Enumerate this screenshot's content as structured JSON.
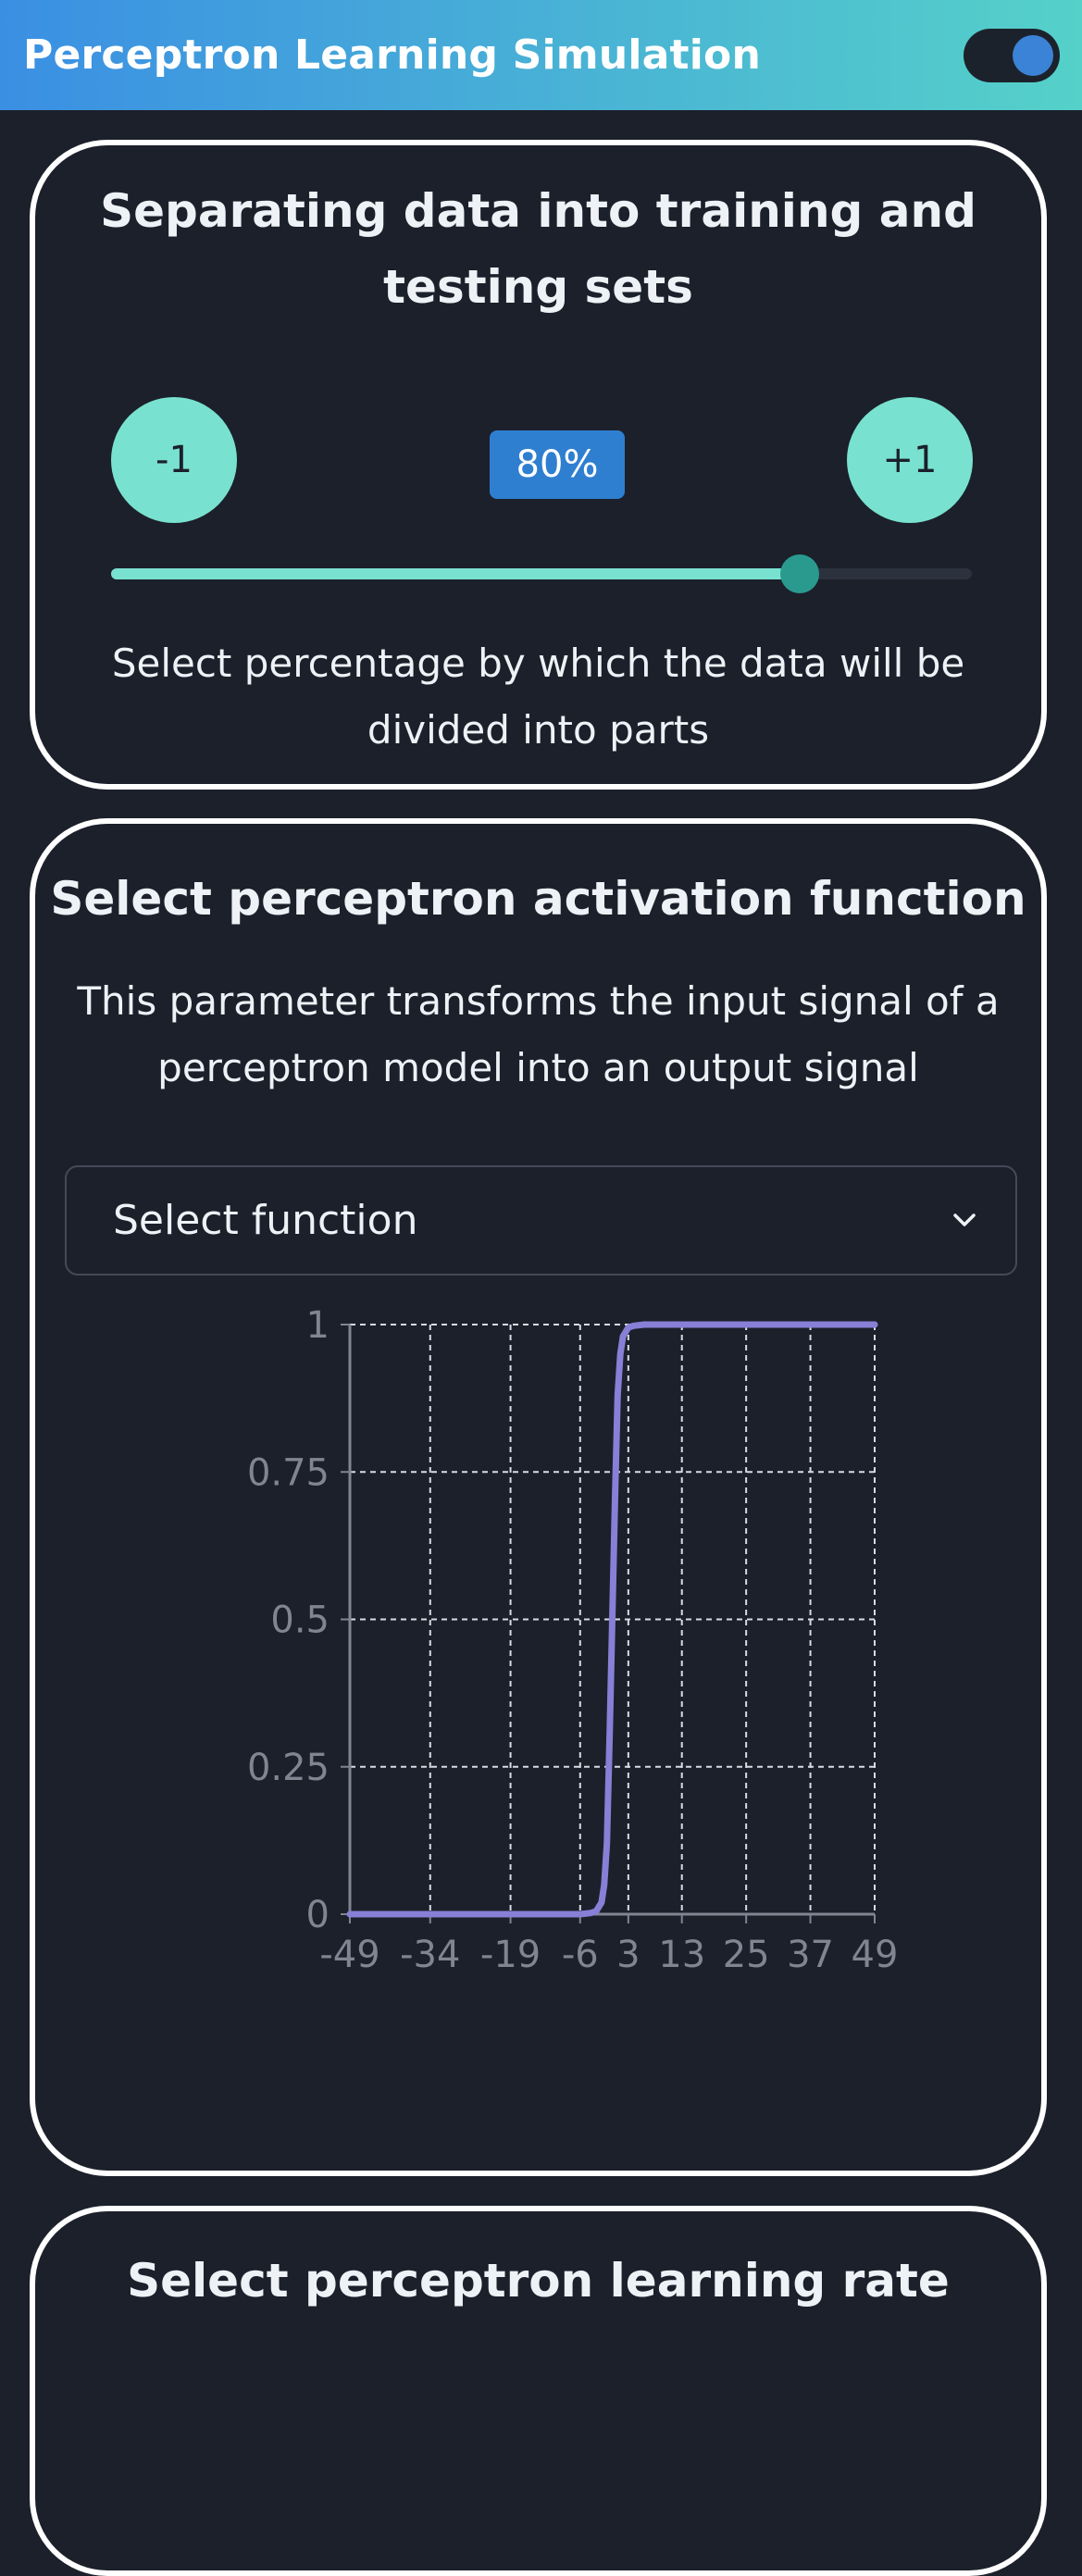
{
  "header": {
    "title": "Perceptron Learning Simulation",
    "theme_toggle_on": true
  },
  "split_card": {
    "title": "Separating data into training and testing sets",
    "decrement_label": "-1",
    "increment_label": "+1",
    "value_label": "80%",
    "slider_value": 0.8,
    "description": "Select percentage by which the data will be divided into parts"
  },
  "activation_card": {
    "title": "Select perceptron activation function",
    "description": "This parameter transforms the input signal of a perceptron model into an output signal",
    "select": {
      "value": "Select function"
    }
  },
  "learning_rate_card": {
    "title": "Select perceptron learning rate"
  },
  "chart_data": {
    "type": "line",
    "title": "",
    "xlabel": "",
    "ylabel": "",
    "x_ticks": [
      "-49",
      "-34",
      "-19",
      "-6",
      "3",
      "13",
      "25",
      "37",
      "49"
    ],
    "y_ticks": [
      "0",
      "0.25",
      "0.5",
      "0.75",
      "1"
    ],
    "grid": true,
    "series": [
      {
        "x": [
          -49,
          -34,
          -19,
          -6,
          -4,
          -3,
          -2,
          -1.5,
          -1,
          -0.5,
          0,
          0.5,
          1,
          1.5,
          2,
          3,
          4,
          6,
          13,
          25,
          37,
          49
        ],
        "y": [
          0,
          0,
          0,
          0,
          0.002,
          0.005,
          0.02,
          0.05,
          0.12,
          0.3,
          0.5,
          0.7,
          0.88,
          0.95,
          0.98,
          0.995,
          0.998,
          1,
          1,
          1,
          1,
          1
        ],
        "color": "#8680d6"
      }
    ],
    "colors": {
      "grid": "#d7dbe2",
      "axis": "#7f8591",
      "line": "#8680d6"
    }
  },
  "colors": {
    "background": "#1b202b",
    "accent": "#79e1cf",
    "badge": "#2f7fd0"
  }
}
